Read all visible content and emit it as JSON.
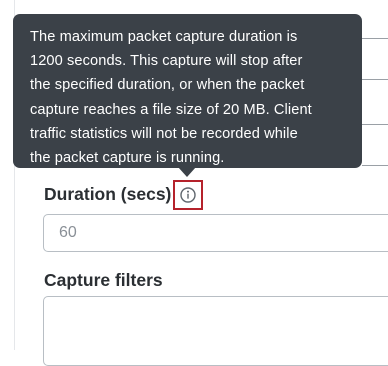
{
  "tooltip": {
    "lines": [
      "The maximum packet capture duration is",
      "1200 seconds. This capture will stop after",
      "the specified duration, or when the packet",
      "capture reaches a file size of 20 MB. Client",
      "traffic statistics will not be recorded while",
      "the packet capture is running."
    ]
  },
  "duration": {
    "label": "Duration (secs)",
    "placeholder": "60",
    "value": ""
  },
  "capture_filters": {
    "label": "Capture filters",
    "value": ""
  },
  "colors": {
    "tooltip_bg": "#3b4148",
    "highlight": "#b5222b",
    "label_text": "#2b2f33",
    "placeholder_text": "#8a9097",
    "input_border": "#b8bec4"
  },
  "icons": {
    "info": "info-circle-icon"
  }
}
